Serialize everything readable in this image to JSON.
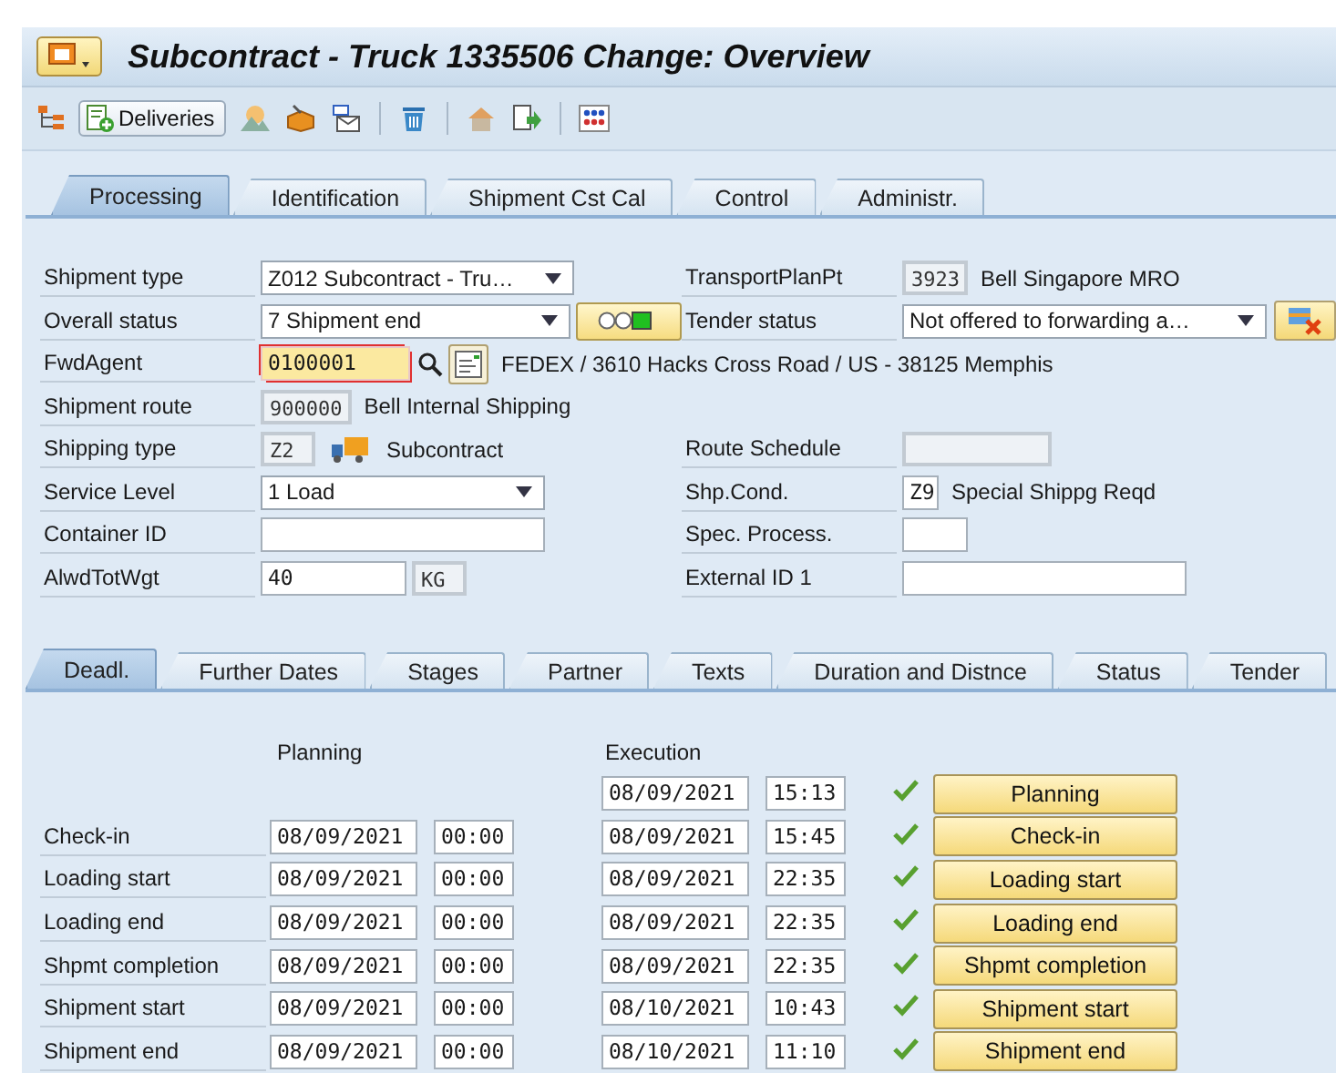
{
  "title": "Subcontract - Truck 1335506 Change: Overview",
  "toolbar": {
    "deliveries_button": "Deliveries"
  },
  "header_tabs": [
    {
      "label": "Processing",
      "selected": true
    },
    {
      "label": "Identification",
      "selected": false
    },
    {
      "label": "Shipment Cst Cal",
      "selected": false
    },
    {
      "label": "Control",
      "selected": false
    },
    {
      "label": "Administr.",
      "selected": false
    }
  ],
  "form_rows": [
    {
      "left": {
        "label": "Shipment type",
        "kind": "dropdown",
        "value": "Z012 Subcontract - Tru…"
      },
      "right": {
        "label": "TransportPlanPt",
        "kind": "code",
        "value": "3923",
        "description": "Bell Singapore MRO"
      }
    },
    {
      "left": {
        "label": "Overall status",
        "kind": "dropdown",
        "value": "7 Shipment end",
        "lights": [
          {
            "on": false
          },
          {
            "on": false
          },
          {
            "on": true
          }
        ]
      },
      "right": {
        "label": "Tender status",
        "kind": "dropdown",
        "value": "Not offered to forwarding a…",
        "tender_button": true
      }
    },
    {
      "left": {
        "label": "FwdAgent",
        "kind": "required",
        "value": "0100001",
        "search_help": true,
        "description": "FEDEX / 3610 Hacks Cross Road / US - 38125 Memphis"
      }
    },
    {
      "left": {
        "label": "Shipment route",
        "kind": "code",
        "value": "900000",
        "description": "Bell Internal Shipping"
      }
    },
    {
      "left": {
        "label": "Shipping type",
        "kind": "code",
        "value": "Z2",
        "truck_icon": true,
        "description": "Subcontract"
      },
      "right": {
        "label": "Route Schedule",
        "kind": "code"
      }
    },
    {
      "left": {
        "label": "Service Level",
        "kind": "dropdown",
        "value": "1 Load"
      },
      "right": {
        "label": "Shp.Cond.",
        "kind": "input",
        "value": "Z9",
        "description": "Special Shippg Reqd"
      }
    },
    {
      "left": {
        "label": "Container ID",
        "kind": "input"
      },
      "right": {
        "label": "Spec. Process.",
        "kind": "input"
      }
    },
    {
      "left": {
        "label": "AlwdTotWgt",
        "kind": "input",
        "value": "40",
        "unit": "KG"
      },
      "right": {
        "label": "External ID 1",
        "kind": "input"
      }
    }
  ],
  "detail_tabs": [
    {
      "label": "Deadl.",
      "selected": true
    },
    {
      "label": "Further Dates",
      "selected": false
    },
    {
      "label": "Stages",
      "selected": false
    },
    {
      "label": "Partner",
      "selected": false
    },
    {
      "label": "Texts",
      "selected": false
    },
    {
      "label": "Duration and Distnce",
      "selected": false
    },
    {
      "label": "Status",
      "selected": false
    },
    {
      "label": "Tender",
      "selected": false
    }
  ],
  "deadlines": {
    "planning_heading": "Planning",
    "execution_heading": "Execution",
    "rows": [
      {
        "exec_date": "08/09/2021",
        "exec_time": "15:13",
        "done": true,
        "button": "Planning"
      },
      {
        "label": "Check-in",
        "plan_date": "08/09/2021",
        "plan_time": "00:00",
        "exec_date": "08/09/2021",
        "exec_time": "15:45",
        "done": true,
        "button": "Check-in"
      },
      {
        "label": "Loading start",
        "plan_date": "08/09/2021",
        "plan_time": "00:00",
        "exec_date": "08/09/2021",
        "exec_time": "22:35",
        "done": true,
        "button": "Loading start"
      },
      {
        "label": "Loading end",
        "plan_date": "08/09/2021",
        "plan_time": "00:00",
        "exec_date": "08/09/2021",
        "exec_time": "22:35",
        "done": true,
        "button": "Loading end"
      },
      {
        "label": "Shpmt completion",
        "plan_date": "08/09/2021",
        "plan_time": "00:00",
        "exec_date": "08/09/2021",
        "exec_time": "22:35",
        "done": true,
        "button": "Shpmt completion"
      },
      {
        "label": "Shipment start",
        "plan_date": "08/09/2021",
        "plan_time": "00:00",
        "exec_date": "08/10/2021",
        "exec_time": "10:43",
        "done": true,
        "button": "Shipment start"
      },
      {
        "label": "Shipment end",
        "plan_date": "08/09/2021",
        "plan_time": "00:00",
        "exec_date": "08/10/2021",
        "exec_time": "11:10",
        "done": true,
        "button": "Shipment end"
      }
    ]
  }
}
